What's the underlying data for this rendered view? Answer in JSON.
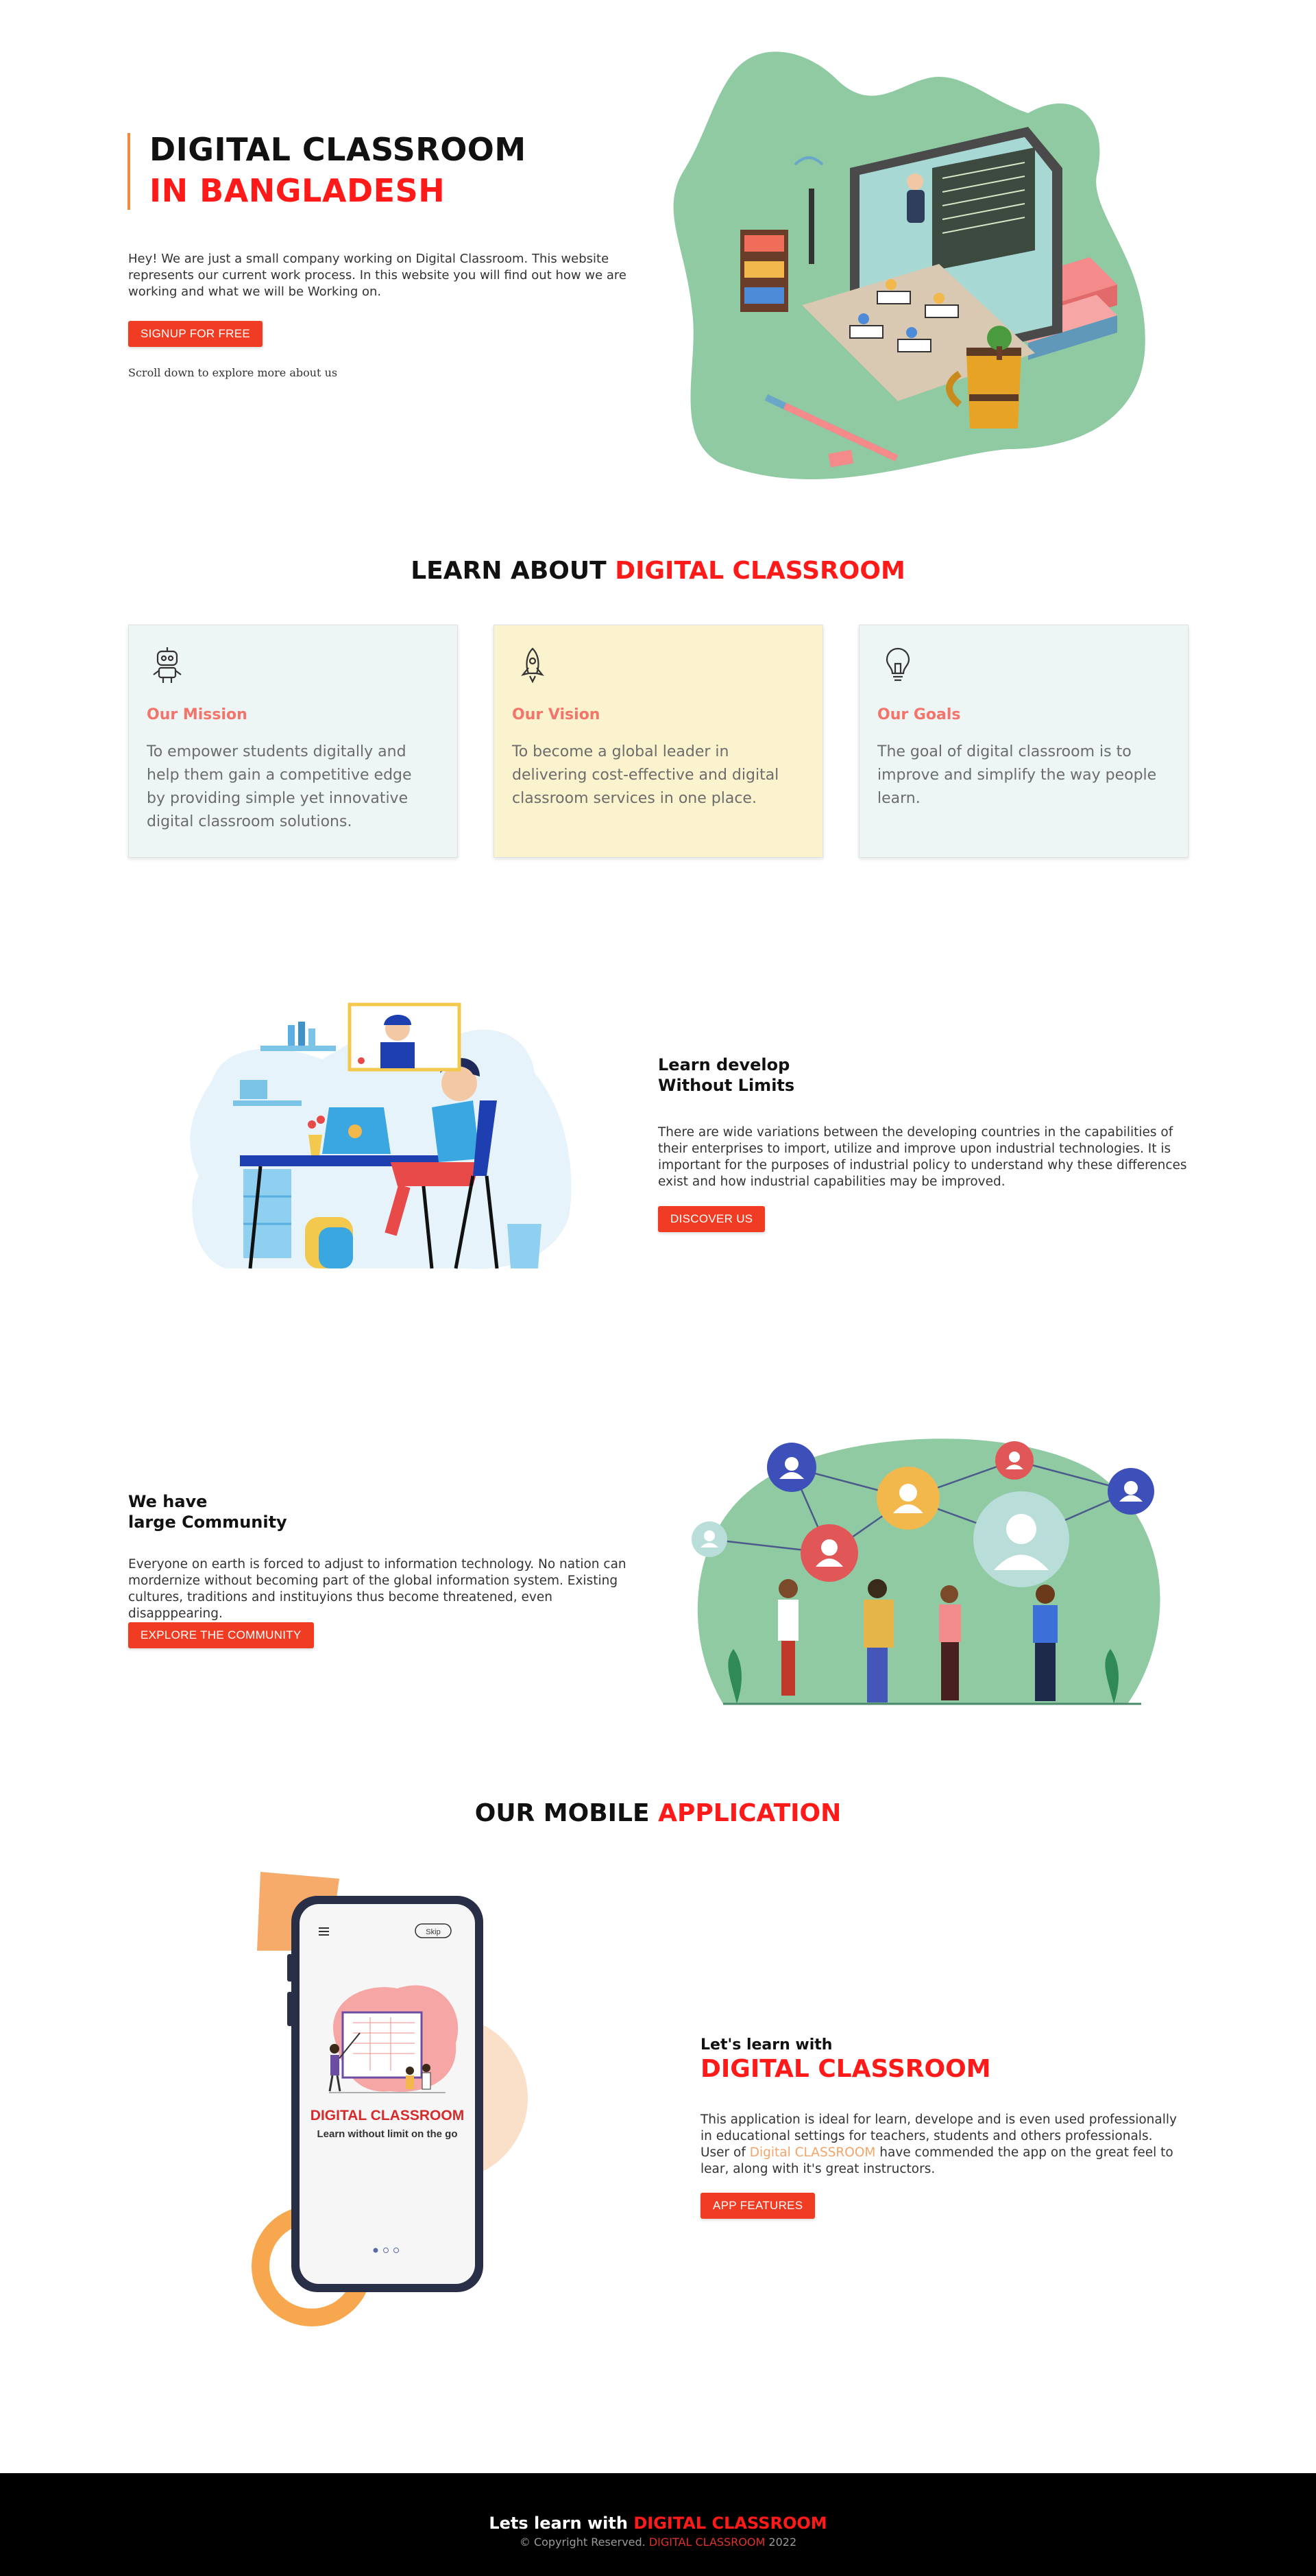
{
  "hero": {
    "title_line1": "DIGITAL CLASSROOM",
    "title_line2": "IN BANGLADESH",
    "description": "Hey! We are just a small company working on Digital Classroom. This website represents our current work process. In this website you will find out how we are working and what we will be Working on.",
    "signup_label": "SIGNUP FOR FREE",
    "scroll_hint": "Scroll down to explore more about us"
  },
  "about": {
    "heading_part1": "LEARN ABOUT ",
    "heading_part2": "DIGITAL CLASSROOM",
    "cards": [
      {
        "icon": "robot-icon",
        "title": "Our Mission",
        "text": "To empower students digitally and help them gain a competitive edge by providing simple yet innovative digital classroom solutions.",
        "bg": "#eef5f5"
      },
      {
        "icon": "rocket-icon",
        "title": "Our Vision",
        "text": "To become a global leader in delivering cost-effective and digital classroom services in one place.",
        "bg": "#fbf3cd"
      },
      {
        "icon": "lightbulb-icon",
        "title": "Our Goals",
        "text": "The goal of digital classroom is to improve and simplify the way people learn.",
        "bg": "#eef5f5"
      }
    ]
  },
  "learn": {
    "title_line1": "Learn develop",
    "title_line2": "Without Limits",
    "text": "There are wide variations between the developing countries in the capabilities of their enterprises to import, utilize and improve upon industrial technologies. It is important for the purposes of industrial policy to understand why these differences exist and how industrial capabilities may be improved.",
    "button_label": "DISCOVER US"
  },
  "community": {
    "title_line1": "We have",
    "title_line2": "large Community",
    "text": "Everyone on earth is forced to adjust to information technology. No nation can mordernize without becoming part of the global information system. Existing cultures, traditions and instituyions thus become threatened, even disapppearing.",
    "button_label": "EXPLORE THE COMMUNITY"
  },
  "mobile": {
    "heading_part1": "OUR MOBILE ",
    "heading_part2": "APPLICATION",
    "subtitle": "Let's learn with",
    "title": "DIGITAL CLASSROOM",
    "text_part1": "This application is ideal for learn, develope and is even used professionally in educational settings for teachers, students and others professionals. User of ",
    "text_highlight": "Digital CLASSROOM",
    "text_part2": " have commended the app on the great feel to lear, along with it's great instructors.",
    "button_label": "APP FEATURES",
    "phone": {
      "skip_label": "Skip",
      "app_title": "DIGITAL CLASSROOM",
      "app_tagline": "Learn without limit on the go"
    }
  },
  "footer": {
    "main_part1": "Lets learn with ",
    "main_part2": "DIGITAL CLASSROOM",
    "copy_part1": "© Copyright Reserved. ",
    "copy_part2": "DIGITAL CLASSROOM",
    "copy_part3": " 2022"
  },
  "colors": {
    "accent_red": "#ff1a1a",
    "button": "#f03c22",
    "card_title": "#f3746a",
    "hero_bar": "#f08b3a",
    "blob_green": "#8fcaa3"
  }
}
